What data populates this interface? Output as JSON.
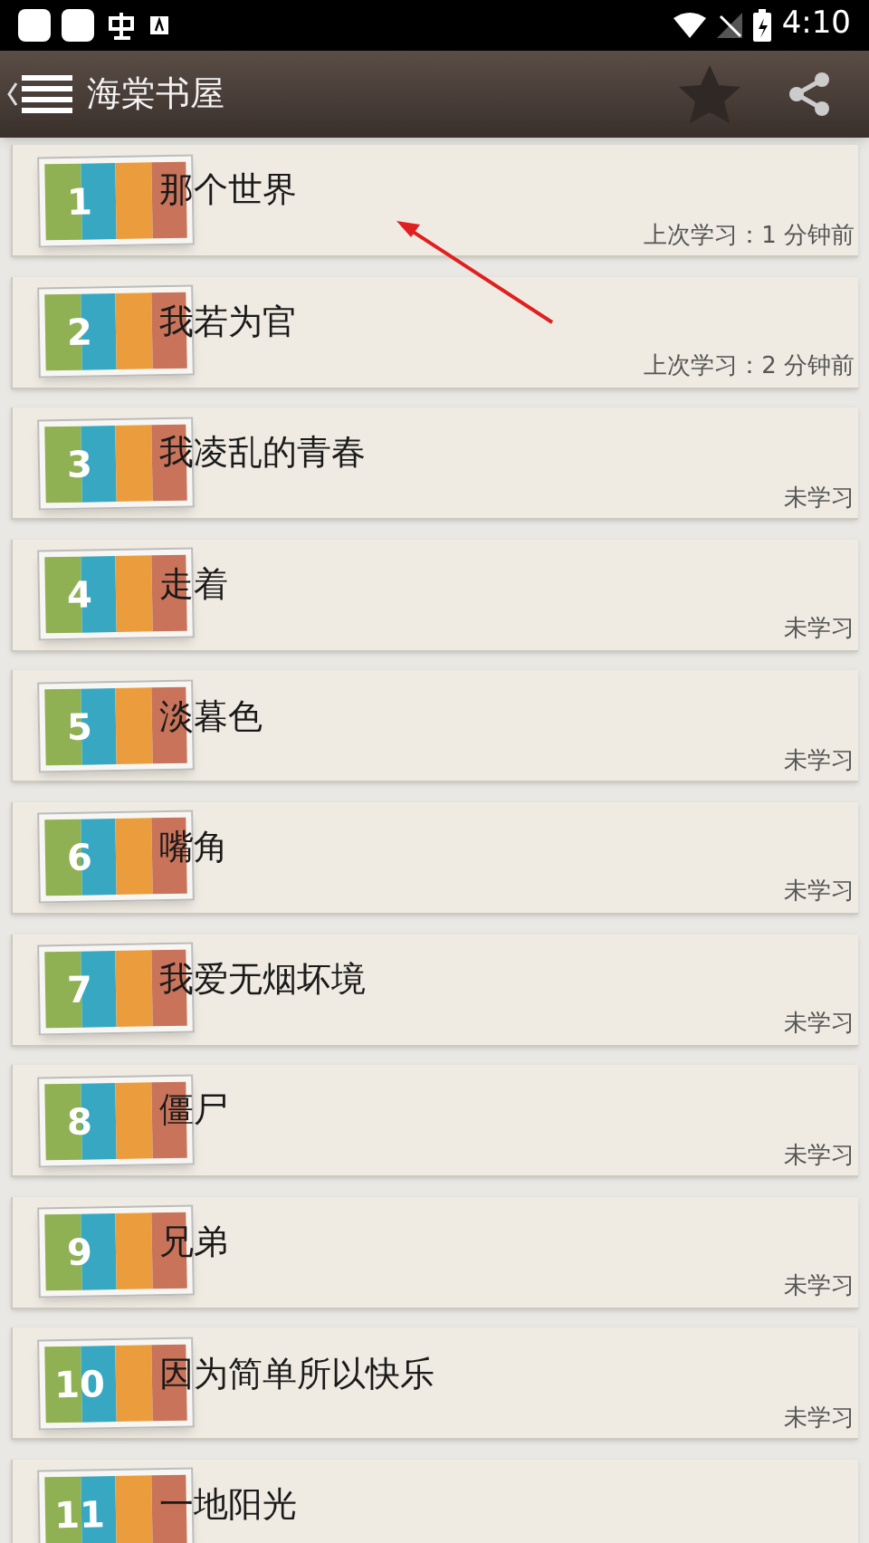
{
  "status_bar": {
    "time": "4:10"
  },
  "header": {
    "title": "海棠书屋"
  },
  "lessons": [
    {
      "number": "1",
      "title": "那个世界",
      "status": "上次学习：1 分钟前"
    },
    {
      "number": "2",
      "title": "我若为官",
      "status": "上次学习：2 分钟前"
    },
    {
      "number": "3",
      "title": "我凌乱的青春",
      "status": "未学习"
    },
    {
      "number": "4",
      "title": "走着",
      "status": "未学习"
    },
    {
      "number": "5",
      "title": "淡暮色",
      "status": "未学习"
    },
    {
      "number": "6",
      "title": "嘴角",
      "status": "未学习"
    },
    {
      "number": "7",
      "title": "我爱无烟坏境",
      "status": "未学习"
    },
    {
      "number": "8",
      "title": "僵尸",
      "status": "未学习"
    },
    {
      "number": "9",
      "title": "兄弟",
      "status": "未学习"
    },
    {
      "number": "10",
      "title": "因为简单所以快乐",
      "status": "未学习"
    },
    {
      "number": "11",
      "title": "一地阳光"
    }
  ]
}
